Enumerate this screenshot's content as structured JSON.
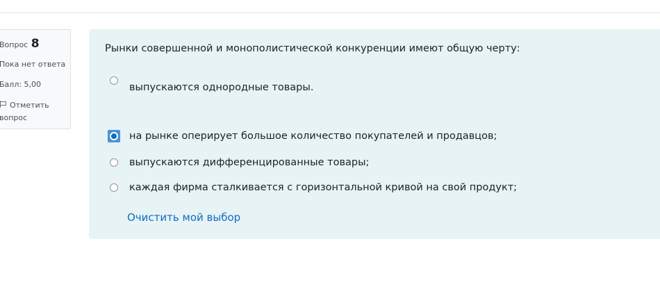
{
  "question_info": {
    "number_label": "Вопрос",
    "number": "8",
    "state": "Пока нет ответа",
    "grade": "Балл: 5,00",
    "flag_label": "Отметить вопрос"
  },
  "question": {
    "text": "Рынки совершенной и монополистической конкуренции имеют общую черту:",
    "options": [
      {
        "label": "выпускаются однородные товары.",
        "focused": false
      },
      {
        "label": "на рынке оперирует большое количество покупателей и продавцов;",
        "focused": true
      },
      {
        "label": "выпускаются дифференцированные товары;",
        "focused": false
      },
      {
        "label": "каждая фирма сталкивается с горизонтальной кривой на свой продукт;",
        "focused": false
      }
    ],
    "clear_label": "Очистить мой выбор"
  },
  "colors": {
    "content_bg": "#e7f3f5",
    "link": "#0f6cbf",
    "focus": "#4a90d9"
  }
}
